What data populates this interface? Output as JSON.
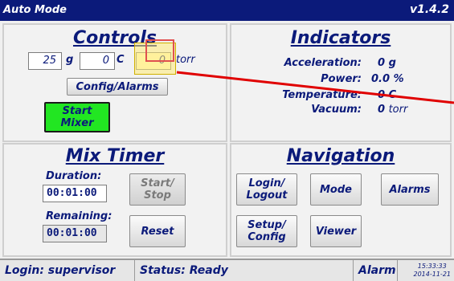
{
  "titlebar": {
    "mode": "Auto Mode",
    "version": "v1.4.2"
  },
  "controls": {
    "title": "Controls",
    "accel_value": "25",
    "accel_unit": "g",
    "temp_value": "0",
    "temp_unit": "C",
    "vacuum_value": "0",
    "vacuum_unit": "torr",
    "config_button": "Config/Alarms",
    "start_mixer_button": "Start Mixer"
  },
  "indicators": {
    "title": "Indicators",
    "rows": [
      {
        "label": "Acceleration:",
        "value": "0",
        "unit": "g"
      },
      {
        "label": "Power:",
        "value": "0.0",
        "unit": "%"
      },
      {
        "label": "Temperature:",
        "value": "0",
        "unit": "C"
      },
      {
        "label": "Vacuum:",
        "value": "0",
        "unit": "torr"
      }
    ]
  },
  "mix_timer": {
    "title": "Mix Timer",
    "duration_label": "Duration:",
    "duration_value": "00:01:00",
    "start_stop_button": "Start/ Stop",
    "remaining_label": "Remaining:",
    "remaining_value": "00:01:00",
    "reset_button": "Reset"
  },
  "navigation": {
    "title": "Navigation",
    "login_button": "Login/ Logout",
    "mode_button": "Mode",
    "alarms_button": "Alarms",
    "setup_button": "Setup/ Config",
    "viewer_button": "Viewer"
  },
  "statusbar": {
    "login": "Login: supervisor",
    "status": "Status: Ready",
    "alarm": "Alarm",
    "time": "15:33:33",
    "date": "2014-11-21"
  },
  "colors": {
    "title_bar": "#0b1a7a",
    "accent_text": "#0b1a7a",
    "start_button": "#22e622",
    "highlight": "#ffeb78",
    "pointer_line": "#e00000"
  }
}
